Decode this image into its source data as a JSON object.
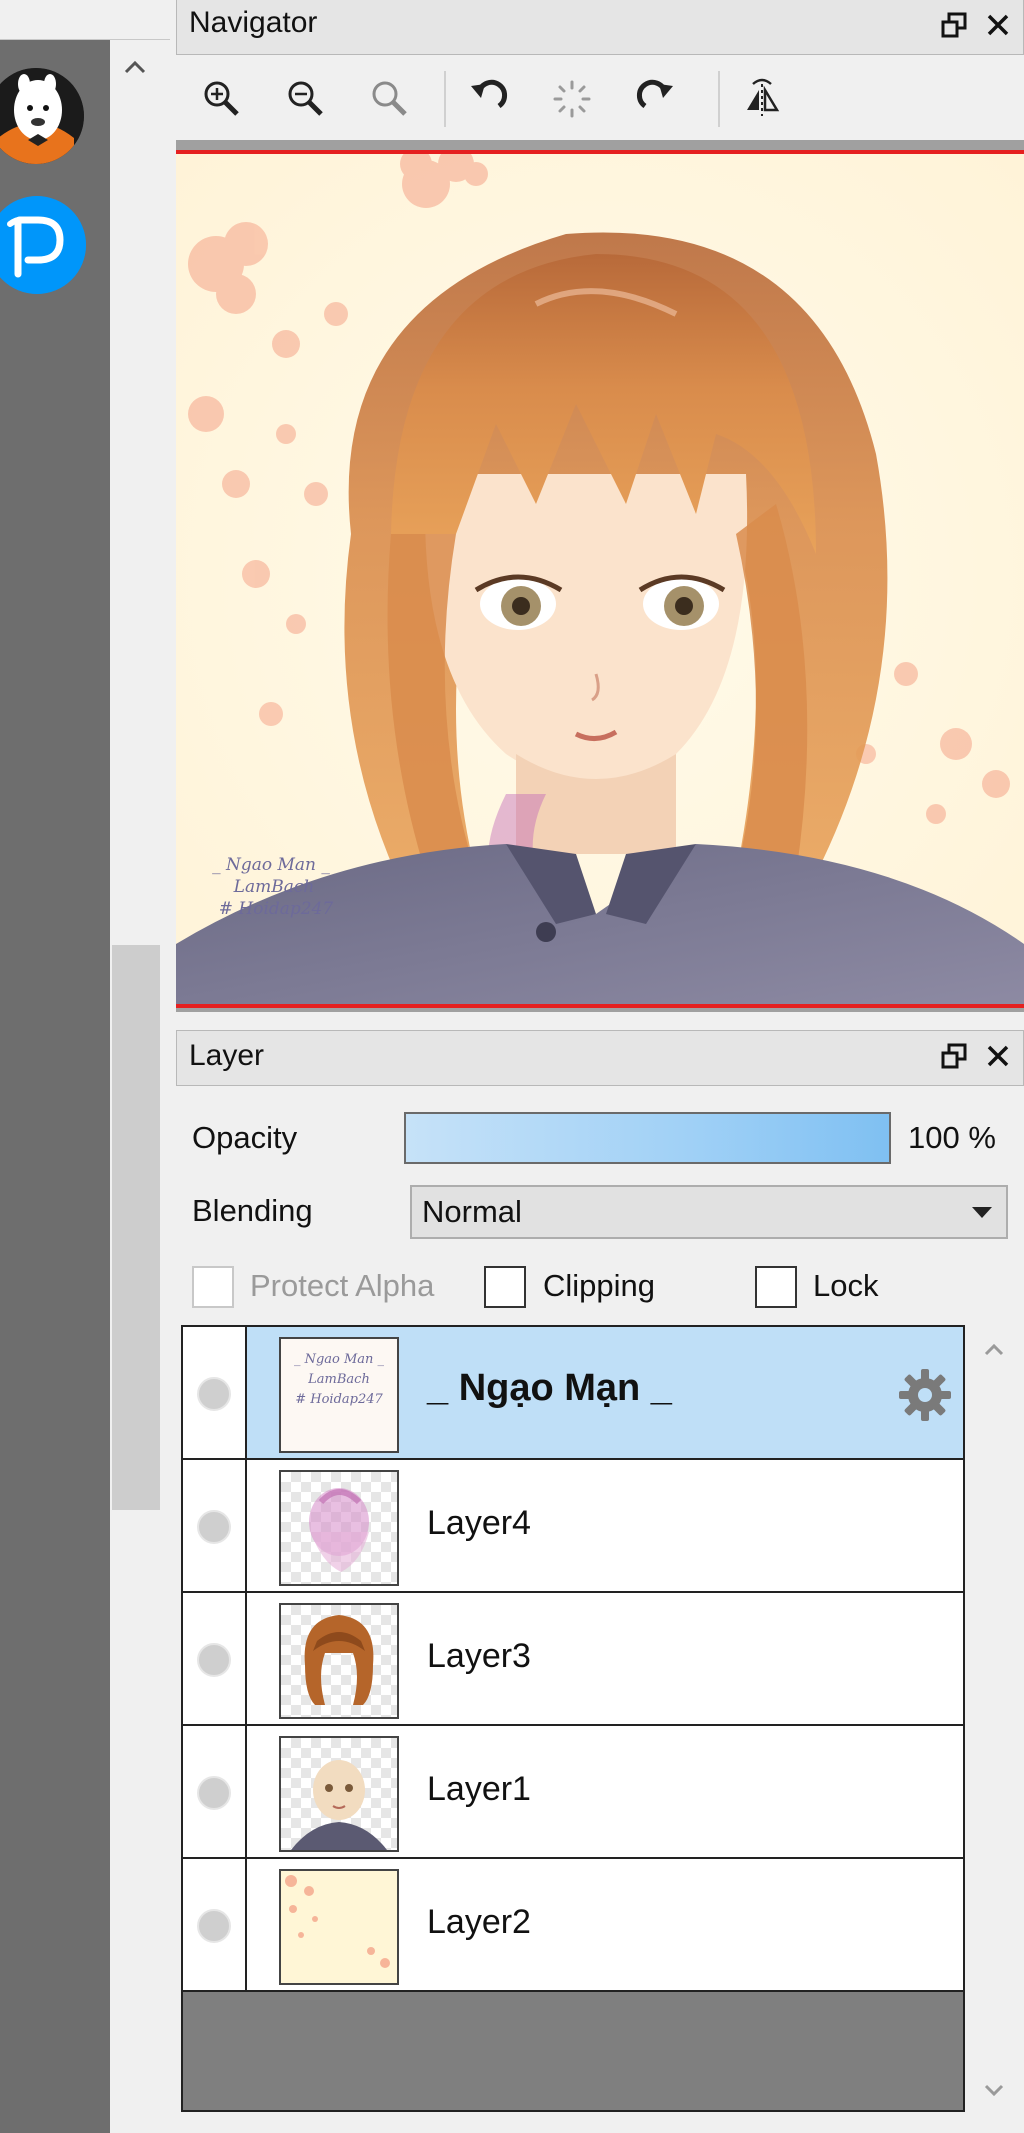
{
  "navigator": {
    "title": "Navigator",
    "tools": [
      "zoom-in-icon",
      "zoom-out-icon",
      "zoom-actual-icon",
      "rotate-left-icon",
      "reset-rotation-icon",
      "rotate-right-icon",
      "flip-horizontal-icon"
    ],
    "preview_watermark": [
      "_ Ngao Man _",
      "LamBach",
      "# Hoidap247"
    ]
  },
  "layer_panel": {
    "title": "Layer",
    "opacity_label": "Opacity",
    "opacity_value": "100 %",
    "opacity_level": 1.0,
    "blending_label": "Blending",
    "blending_value": "Normal",
    "protect_alpha_label": "Protect Alpha",
    "clipping_label": "Clipping",
    "lock_label": "Lock",
    "layers": [
      {
        "name": "_ Ngạo Mạn _",
        "selected": true
      },
      {
        "name": "Layer4",
        "selected": false
      },
      {
        "name": "Layer3",
        "selected": false
      },
      {
        "name": "Layer1",
        "selected": false
      },
      {
        "name": "Layer2",
        "selected": false
      }
    ]
  },
  "colors": {
    "selected_row": "#bfdff7",
    "preview_border": "#e52020",
    "pixiv_blue": "#0096fa"
  }
}
